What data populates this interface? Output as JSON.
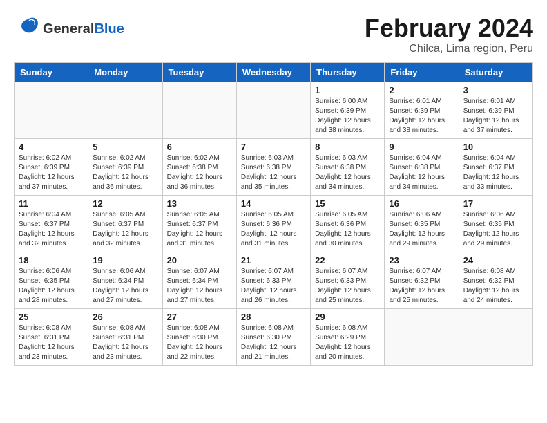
{
  "header": {
    "logo_general": "General",
    "logo_blue": "Blue",
    "title": "February 2024",
    "subtitle": "Chilca, Lima region, Peru"
  },
  "days_of_week": [
    "Sunday",
    "Monday",
    "Tuesday",
    "Wednesday",
    "Thursday",
    "Friday",
    "Saturday"
  ],
  "weeks": [
    [
      {
        "day": "",
        "info": ""
      },
      {
        "day": "",
        "info": ""
      },
      {
        "day": "",
        "info": ""
      },
      {
        "day": "",
        "info": ""
      },
      {
        "day": "1",
        "info": "Sunrise: 6:00 AM\nSunset: 6:39 PM\nDaylight: 12 hours\nand 38 minutes."
      },
      {
        "day": "2",
        "info": "Sunrise: 6:01 AM\nSunset: 6:39 PM\nDaylight: 12 hours\nand 38 minutes."
      },
      {
        "day": "3",
        "info": "Sunrise: 6:01 AM\nSunset: 6:39 PM\nDaylight: 12 hours\nand 37 minutes."
      }
    ],
    [
      {
        "day": "4",
        "info": "Sunrise: 6:02 AM\nSunset: 6:39 PM\nDaylight: 12 hours\nand 37 minutes."
      },
      {
        "day": "5",
        "info": "Sunrise: 6:02 AM\nSunset: 6:39 PM\nDaylight: 12 hours\nand 36 minutes."
      },
      {
        "day": "6",
        "info": "Sunrise: 6:02 AM\nSunset: 6:38 PM\nDaylight: 12 hours\nand 36 minutes."
      },
      {
        "day": "7",
        "info": "Sunrise: 6:03 AM\nSunset: 6:38 PM\nDaylight: 12 hours\nand 35 minutes."
      },
      {
        "day": "8",
        "info": "Sunrise: 6:03 AM\nSunset: 6:38 PM\nDaylight: 12 hours\nand 34 minutes."
      },
      {
        "day": "9",
        "info": "Sunrise: 6:04 AM\nSunset: 6:38 PM\nDaylight: 12 hours\nand 34 minutes."
      },
      {
        "day": "10",
        "info": "Sunrise: 6:04 AM\nSunset: 6:37 PM\nDaylight: 12 hours\nand 33 minutes."
      }
    ],
    [
      {
        "day": "11",
        "info": "Sunrise: 6:04 AM\nSunset: 6:37 PM\nDaylight: 12 hours\nand 32 minutes."
      },
      {
        "day": "12",
        "info": "Sunrise: 6:05 AM\nSunset: 6:37 PM\nDaylight: 12 hours\nand 32 minutes."
      },
      {
        "day": "13",
        "info": "Sunrise: 6:05 AM\nSunset: 6:37 PM\nDaylight: 12 hours\nand 31 minutes."
      },
      {
        "day": "14",
        "info": "Sunrise: 6:05 AM\nSunset: 6:36 PM\nDaylight: 12 hours\nand 31 minutes."
      },
      {
        "day": "15",
        "info": "Sunrise: 6:05 AM\nSunset: 6:36 PM\nDaylight: 12 hours\nand 30 minutes."
      },
      {
        "day": "16",
        "info": "Sunrise: 6:06 AM\nSunset: 6:35 PM\nDaylight: 12 hours\nand 29 minutes."
      },
      {
        "day": "17",
        "info": "Sunrise: 6:06 AM\nSunset: 6:35 PM\nDaylight: 12 hours\nand 29 minutes."
      }
    ],
    [
      {
        "day": "18",
        "info": "Sunrise: 6:06 AM\nSunset: 6:35 PM\nDaylight: 12 hours\nand 28 minutes."
      },
      {
        "day": "19",
        "info": "Sunrise: 6:06 AM\nSunset: 6:34 PM\nDaylight: 12 hours\nand 27 minutes."
      },
      {
        "day": "20",
        "info": "Sunrise: 6:07 AM\nSunset: 6:34 PM\nDaylight: 12 hours\nand 27 minutes."
      },
      {
        "day": "21",
        "info": "Sunrise: 6:07 AM\nSunset: 6:33 PM\nDaylight: 12 hours\nand 26 minutes."
      },
      {
        "day": "22",
        "info": "Sunrise: 6:07 AM\nSunset: 6:33 PM\nDaylight: 12 hours\nand 25 minutes."
      },
      {
        "day": "23",
        "info": "Sunrise: 6:07 AM\nSunset: 6:32 PM\nDaylight: 12 hours\nand 25 minutes."
      },
      {
        "day": "24",
        "info": "Sunrise: 6:08 AM\nSunset: 6:32 PM\nDaylight: 12 hours\nand 24 minutes."
      }
    ],
    [
      {
        "day": "25",
        "info": "Sunrise: 6:08 AM\nSunset: 6:31 PM\nDaylight: 12 hours\nand 23 minutes."
      },
      {
        "day": "26",
        "info": "Sunrise: 6:08 AM\nSunset: 6:31 PM\nDaylight: 12 hours\nand 23 minutes."
      },
      {
        "day": "27",
        "info": "Sunrise: 6:08 AM\nSunset: 6:30 PM\nDaylight: 12 hours\nand 22 minutes."
      },
      {
        "day": "28",
        "info": "Sunrise: 6:08 AM\nSunset: 6:30 PM\nDaylight: 12 hours\nand 21 minutes."
      },
      {
        "day": "29",
        "info": "Sunrise: 6:08 AM\nSunset: 6:29 PM\nDaylight: 12 hours\nand 20 minutes."
      },
      {
        "day": "",
        "info": ""
      },
      {
        "day": "",
        "info": ""
      }
    ]
  ]
}
